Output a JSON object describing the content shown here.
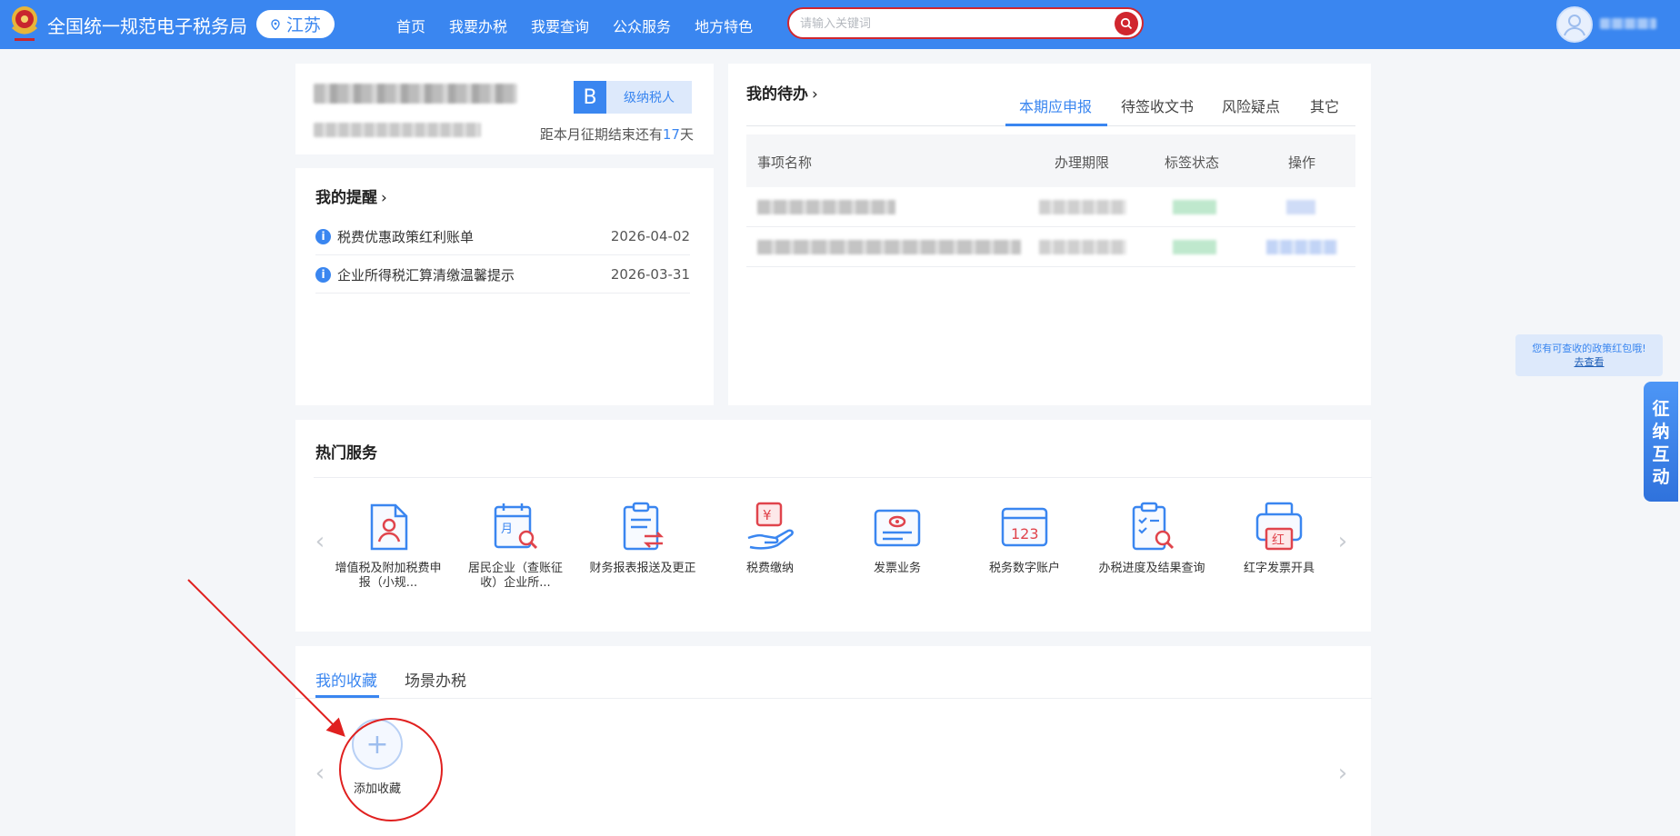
{
  "header": {
    "site_title": "全国统一规范电子税务局",
    "region": "江苏",
    "nav": [
      "首页",
      "我要办税",
      "我要查询",
      "公众服务",
      "地方特色"
    ],
    "search_placeholder": "请输入关键词",
    "brand_color": "#3a86f0",
    "search_accent": "#d0262e"
  },
  "account": {
    "level_letter": "B",
    "level_label": "级纳税人",
    "deadline_prefix": "距本月征期结束还有",
    "deadline_days": "17",
    "deadline_suffix": "天"
  },
  "reminders": {
    "title": "我的提醒",
    "items": [
      {
        "text": "税费优惠政策红利账单",
        "date": "2026-04-02"
      },
      {
        "text": "企业所得税汇算清缴温馨提示",
        "date": "2026-03-31"
      }
    ]
  },
  "todo": {
    "title": "我的待办",
    "tabs": [
      "本期应申报",
      "待签收文书",
      "风险疑点",
      "其它"
    ],
    "active_tab": 0,
    "columns": [
      "事项名称",
      "办理期限",
      "标签状态",
      "操作"
    ]
  },
  "hot_services": {
    "title": "热门服务",
    "items": [
      {
        "label": "增值税及附加税费申报（小规...",
        "icon": "person-document-icon"
      },
      {
        "label": "居民企业（查账征收）企业所...",
        "icon": "calendar-search-icon"
      },
      {
        "label": "财务报表报送及更正",
        "icon": "clipboard-exchange-icon"
      },
      {
        "label": "税费缴纳",
        "icon": "yuan-hand-icon"
      },
      {
        "label": "发票业务",
        "icon": "invoice-icon"
      },
      {
        "label": "税务数字账户",
        "icon": "digital-account-123-icon"
      },
      {
        "label": "办税进度及结果查询",
        "icon": "checklist-search-icon"
      },
      {
        "label": "红字发票开具",
        "icon": "printer-red-icon"
      }
    ]
  },
  "favorites": {
    "tabs": [
      "我的收藏",
      "场景办税"
    ],
    "active_tab": 0,
    "add_label": "添加收藏"
  },
  "float_notice": {
    "line1": "您有可查收的政策红包哦!",
    "link": "去查看"
  },
  "float_side": {
    "chars": [
      "征",
      "纳",
      "互",
      "动"
    ]
  }
}
